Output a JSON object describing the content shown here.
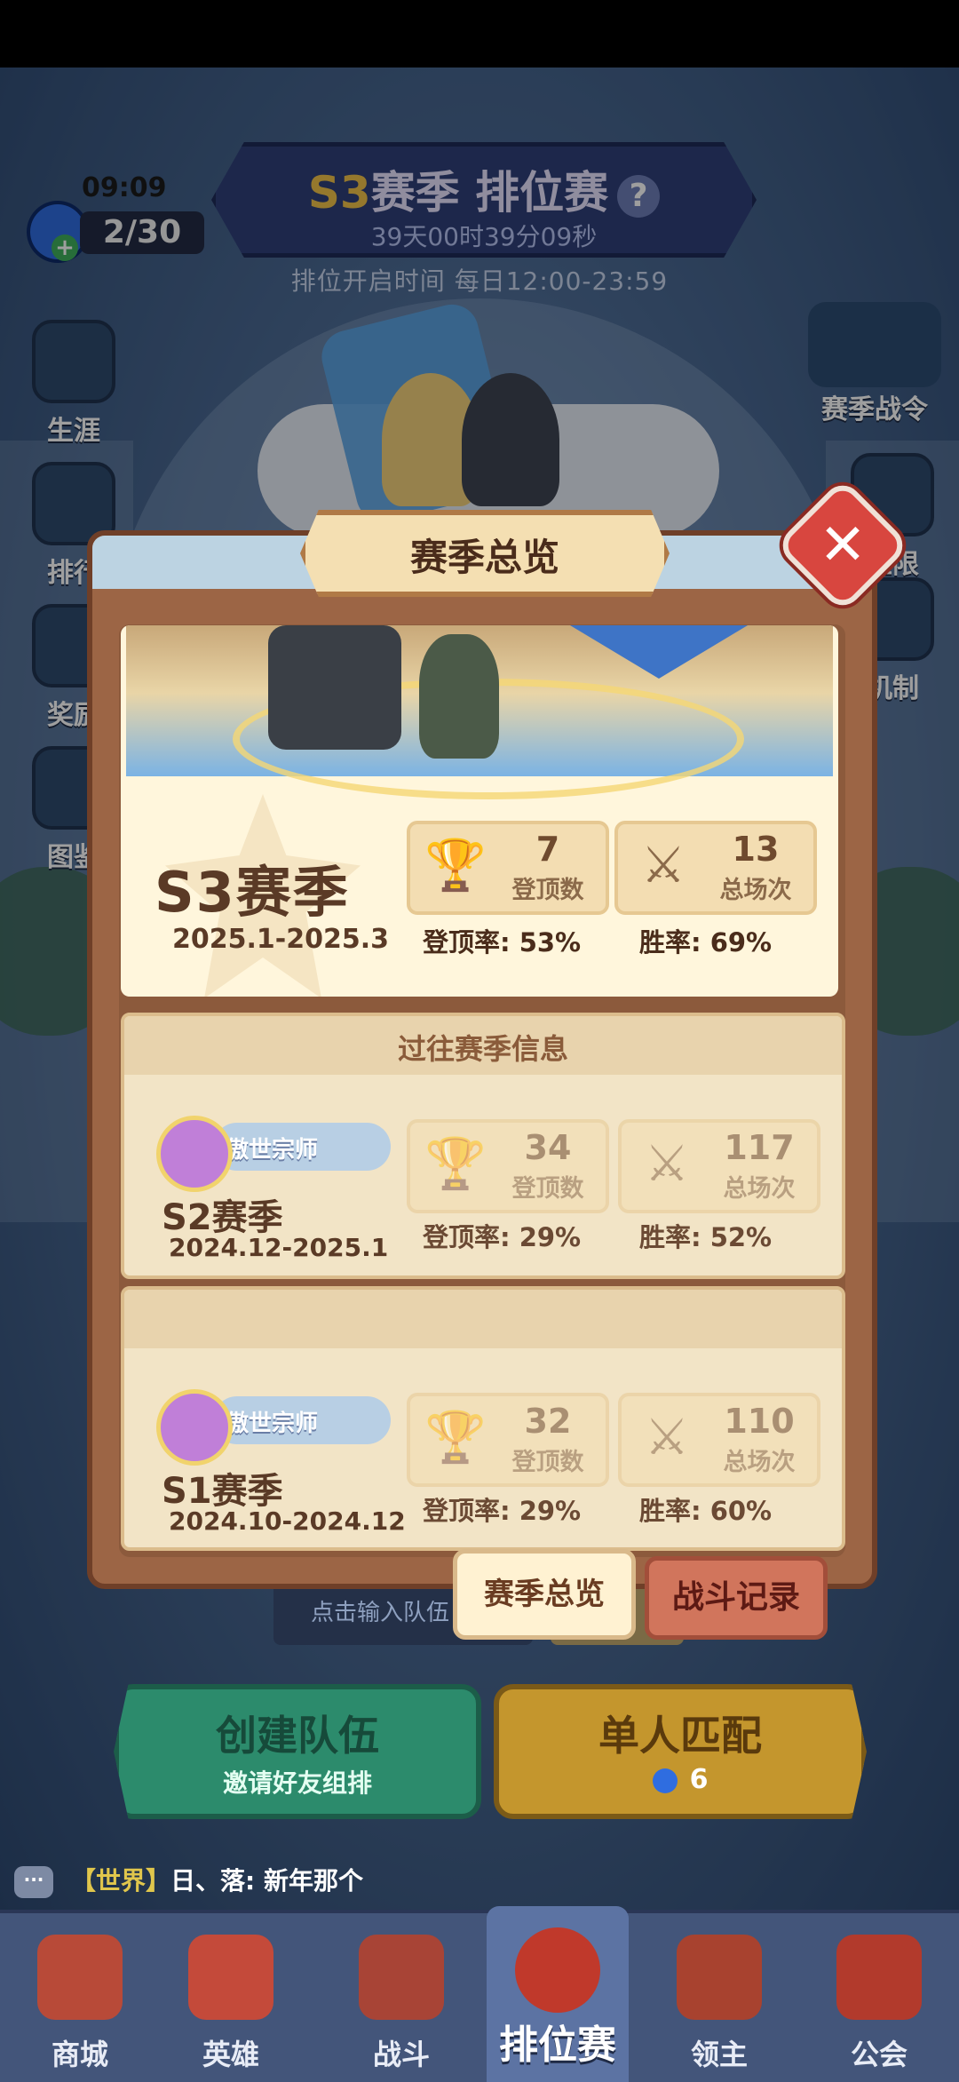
{
  "hud": {
    "clock": "09:09",
    "stamina": "2/30",
    "season_title_prefix": "S3",
    "season_title_rest": "赛季 排位赛",
    "season_timer": "39天00时39分09秒",
    "ranked_hours": "排位开启时间 每日12:00-23:59",
    "side_buttons": [
      "生涯",
      "排行",
      "奖励",
      "图鉴"
    ],
    "right_buttons": [
      "赛季战令",
      "上限",
      "机制"
    ]
  },
  "panel": {
    "title": "赛季总览",
    "close_icon": "close-icon",
    "current": {
      "season": "S3赛季",
      "range": "2025.1-2025.3",
      "tops": "7",
      "tops_label": "登顶数",
      "games": "13",
      "games_label": "总场次",
      "top_rate": "登顶率: 53%",
      "win_rate": "胜率: 69%"
    },
    "past_header": "过往赛季信息",
    "past": [
      {
        "rank": "傲世宗师",
        "season": "S2赛季",
        "range": "2024.12-2025.1",
        "tops": "34",
        "tops_label": "登顶数",
        "games": "117",
        "games_label": "总场次",
        "top_rate": "登顶率: 29%",
        "win_rate": "胜率: 52%"
      },
      {
        "rank": "傲世宗师",
        "season": "S1赛季",
        "range": "2024.10-2024.12",
        "tops": "32",
        "tops_label": "登顶数",
        "games": "110",
        "games_label": "总场次",
        "top_rate": "登顶率: 29%",
        "win_rate": "胜率: 60%"
      }
    ],
    "tabs": {
      "overview": "赛季总览",
      "records": "战斗记录"
    }
  },
  "lobby": {
    "team_input_placeholder": "点击输入队伍",
    "create_team": "创建队伍",
    "create_team_sub": "邀请好友组排",
    "solo_match": "单人匹配",
    "solo_cost": "6"
  },
  "chat": {
    "channel": "【世界】",
    "message": "日、落: 新年那个"
  },
  "nav": {
    "items": [
      "商城",
      "英雄",
      "战斗",
      "排位赛",
      "领主",
      "公会"
    ],
    "active": "排位赛"
  },
  "colors": {
    "panel_brown": "#9c6545",
    "parchment": "#fff6dc",
    "accent_gold": "#f0c24a",
    "close_red": "#d8463f"
  }
}
